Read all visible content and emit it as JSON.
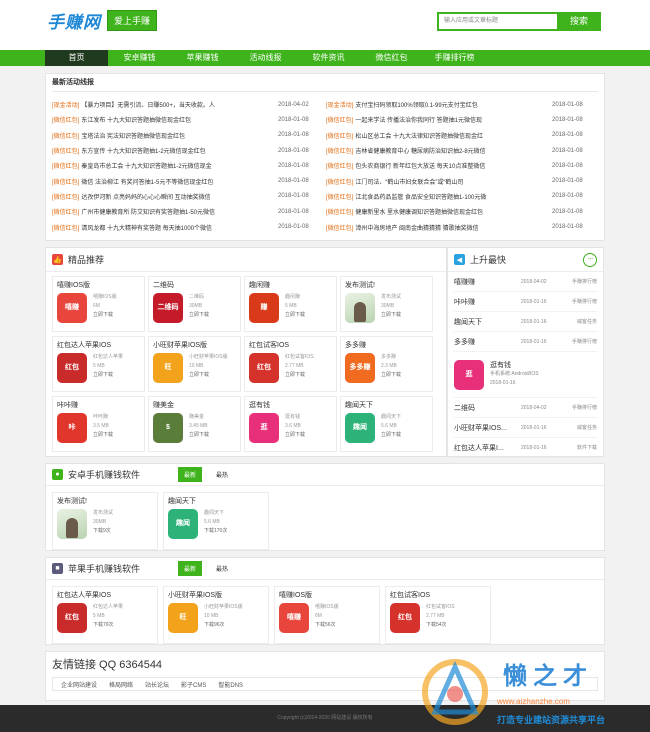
{
  "header": {
    "logo_text": "手赚网",
    "slogan": "爱上手赚",
    "search_placeholder": "输入应用或文章标题",
    "search_button": "搜索"
  },
  "nav": [
    "首页",
    "安卓赚钱",
    "苹果赚钱",
    "活动线报",
    "软件资讯",
    "微信红包",
    "手赚排行榜"
  ],
  "news": {
    "title": "最新活动线报",
    "left": [
      {
        "tag": "[现金活动]",
        "text": "【暴力项目】无需引流、日赚500+，当天收款。人",
        "date": "2018-04-02"
      },
      {
        "tag": "[微信红包]",
        "text": "东江发布 十九大知识答题抽微信现金红包",
        "date": "2018-01-08"
      },
      {
        "tag": "[微信红包]",
        "text": "宝塔法治 宪法知识答题抽微信现金红包",
        "date": "2018-01-08"
      },
      {
        "tag": "[微信红包]",
        "text": "东方宣传 十九大知识答题抽1-2元微信现金红包",
        "date": "2018-01-08"
      },
      {
        "tag": "[微信红包]",
        "text": "秦皇岛市总工会 十九大知识答题抽1-2元微信现金",
        "date": "2018-01-08"
      },
      {
        "tag": "[微信红包]",
        "text": "微信 法治柳江 有奖问答抽1-5元不等微信现金红包",
        "date": "2018-01-08"
      },
      {
        "tag": "[微信红包]",
        "text": "达孜伊河新 点亮妈妈的心心心瞬间 互动抽奖微信",
        "date": "2018-01-08"
      },
      {
        "tag": "[微信红包]",
        "text": "广州市健康教育所 防艾知识有奖答题抽1-50元微信",
        "date": "2018-01-08"
      },
      {
        "tag": "[微信红包]",
        "text": "清风龙都 十九大精神有奖答题 每天抽1000个微信",
        "date": "2018-01-08"
      }
    ],
    "right": [
      {
        "tag": "[现金活动]",
        "text": "支付宝扫码领取100%领取0.1-99元支付宝红包",
        "date": "2018-01-08"
      },
      {
        "tag": "[微信红包]",
        "text": "一起来学法 传播法治你我同行 答题抽1元微信现",
        "date": "2018-01-08"
      },
      {
        "tag": "[微信红包]",
        "text": "松山区总工会 十九大法律知识答题抽微信现金红",
        "date": "2018-01-08"
      },
      {
        "tag": "[微信红包]",
        "text": "吉林省健康教育中心 糖尿病防治知识抽2-8元微信",
        "date": "2018-01-08"
      },
      {
        "tag": "[微信红包]",
        "text": "包头农商银行 新年红包大放送 每天10点准整微信",
        "date": "2018-01-08"
      },
      {
        "tag": "[微信红包]",
        "text": "江门司法、“鹤山市妇女联合会”或“鹤山司",
        "date": "2018-01-08"
      },
      {
        "tag": "[微信红包]",
        "text": "江北食品药品监管 食品安全知识答题抽1-100元微",
        "date": "2018-01-08"
      },
      {
        "tag": "[微信红包]",
        "text": "健康新里水 里水健康调知识答题抽微信现金红包",
        "date": "2018-01-08"
      },
      {
        "tag": "[微信红包]",
        "text": "漳州中海房地产 闽南金曲猜猜猜 猜歌抽奖微信",
        "date": "2018-01-08"
      }
    ]
  },
  "picks": {
    "title": "精品推荐",
    "items": [
      {
        "name": "嘻赚IOS版",
        "sub": "嘻赚IOS版",
        "size": "6M",
        "dl": "立即下载",
        "icon": "嘻赚",
        "color": "#e8453c"
      },
      {
        "name": "二维码",
        "sub": "二维码",
        "size": "30MB",
        "dl": "立即下载",
        "icon": "二维码",
        "color": "#c41a2a"
      },
      {
        "name": "趣闲赚",
        "sub": "趣闲赚",
        "size": "5 MB",
        "dl": "立即下载",
        "icon": "赚",
        "color": "#d93a1a"
      },
      {
        "name": "发布测试!",
        "sub": "发布测试",
        "size": "30MB",
        "dl": "立即下载",
        "icon": "",
        "color": "#cfe2c8"
      },
      {
        "name": "红包达人苹果IOS",
        "sub": "红包达人苹果",
        "size": "5 MB",
        "dl": "立即下载",
        "icon": "红包",
        "color": "#c92a2a"
      },
      {
        "name": "小旺财苹果IOS版",
        "sub": "小旺财苹果IOS版",
        "size": "10 MB",
        "dl": "立即下载",
        "icon": "旺",
        "color": "#f2a21b"
      },
      {
        "name": "红包试客IOS",
        "sub": "红包试客IOS",
        "size": "2.77 MB",
        "dl": "立即下载",
        "icon": "红包",
        "color": "#d6322c"
      },
      {
        "name": "多多赚",
        "sub": "多多赚",
        "size": "2.3 MB",
        "dl": "立即下载",
        "icon": "多多赚",
        "color": "#f06a1f"
      },
      {
        "name": "咔咔赚",
        "sub": "咔咔赚",
        "size": "3.5 MB",
        "dl": "立即下载",
        "icon": "咔",
        "color": "#e0362c"
      },
      {
        "name": "赚美金",
        "sub": "赚美金",
        "size": "3.45 MB",
        "dl": "立即下载",
        "icon": "$",
        "color": "#5a7d3a"
      },
      {
        "name": "逛有钱",
        "sub": "逛有钱",
        "size": "3.6 MB",
        "dl": "立即下载",
        "icon": "逛",
        "color": "#e8307a"
      },
      {
        "name": "趣闻天下",
        "sub": "趣闻天下",
        "size": "5.6 MB",
        "dl": "立即下载",
        "icon": "趣闻",
        "color": "#2db37a"
      }
    ]
  },
  "rising": {
    "title": "上升最快",
    "rows_top": [
      {
        "name": "嘻赚赚",
        "date": "2018-04-02",
        "cat": "手赚排行榜"
      },
      {
        "name": "咔咔赚",
        "date": "2018-01-16",
        "cat": "手赚排行榜"
      },
      {
        "name": "趣闻天下",
        "date": "2018-01-16",
        "cat": "威客任务"
      },
      {
        "name": "多多赚",
        "date": "2018-01-16",
        "cat": "手赚排行榜"
      }
    ],
    "featured": {
      "name": "逛有钱",
      "system": "手机系统:Android/IOS",
      "date": "2018-01-16",
      "icon": "逛",
      "color": "#e8307a"
    },
    "rows_bottom": [
      {
        "name": "二维码",
        "date": "2018-04-02",
        "cat": "手赚排行榜"
      },
      {
        "name": "小旺财苹果IOS...",
        "date": "2018-01-16",
        "cat": "威客任务"
      },
      {
        "name": "红包达人苹果I...",
        "date": "2018-01-16",
        "cat": "软件下载"
      }
    ]
  },
  "android": {
    "title": "安卓手机赚钱软件",
    "tab_new": "最新",
    "tab_hot": "最热",
    "items": [
      {
        "name": "发布测试!",
        "sub": "发布测试",
        "size": "30MB",
        "dl": "下载9次",
        "icon": "",
        "color": "#cfe2c8"
      },
      {
        "name": "趣闻天下",
        "sub": "趣闻天下",
        "size": "5.6 MB",
        "dl": "下载170次",
        "icon": "趣闻",
        "color": "#2db37a"
      }
    ]
  },
  "apple": {
    "title": "苹果手机赚钱软件",
    "tab_new": "最新",
    "tab_hot": "最热",
    "items": [
      {
        "name": "红包达人苹果IOS",
        "sub": "红包达人苹果",
        "size": "5 MB",
        "dl": "下载79次",
        "icon": "红包",
        "color": "#c92a2a"
      },
      {
        "name": "小旺财苹果IOS版",
        "sub": "小旺财苹果IOS版",
        "size": "10 MB",
        "dl": "下载96次",
        "icon": "旺",
        "color": "#f2a21b"
      },
      {
        "name": "嘻赚IOS版",
        "sub": "嘻赚IOS版",
        "size": "6M",
        "dl": "下载56次",
        "icon": "嘻赚",
        "color": "#e8453c"
      },
      {
        "name": "红包试客IOS",
        "sub": "红包试客IOS",
        "size": "2.77 MB",
        "dl": "下载54次",
        "icon": "红包",
        "color": "#d6322c"
      }
    ]
  },
  "links": {
    "title": "友情链接 QQ 6364544",
    "items": [
      "企业网站建设",
      "格局网络",
      "站长论坛",
      "影子CMS",
      "智能DNS"
    ]
  },
  "footer": {
    "text": "Copyright (c)2014-2020 网站建设 版权所有"
  },
  "watermark": {
    "brand": "懒之才",
    "url": "www.aizhanzhe.com",
    "slogan": "打造专业建站资源共享平台"
  }
}
